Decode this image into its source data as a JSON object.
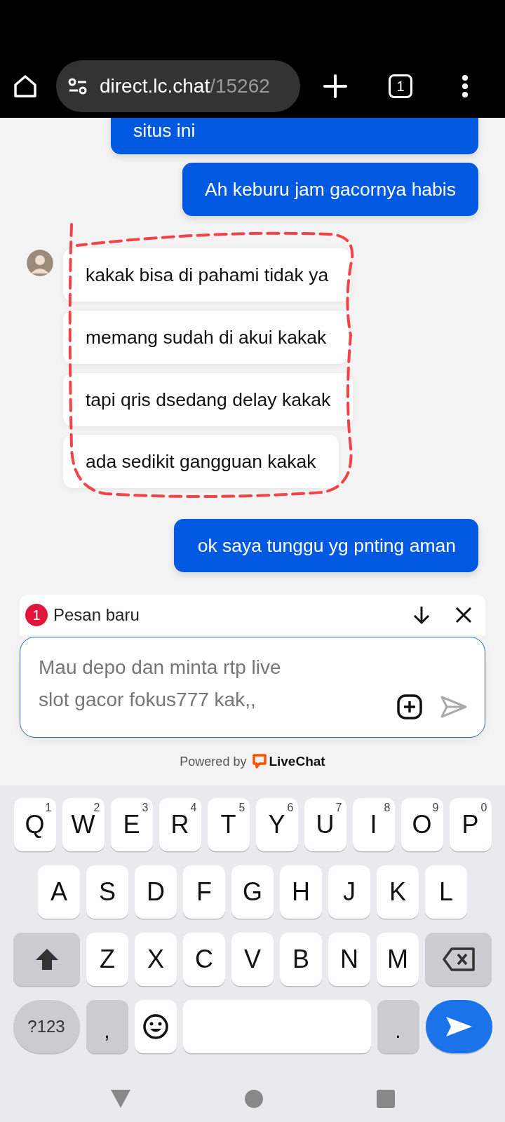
{
  "browser": {
    "url_host": "direct.lc.chat",
    "url_path": "/15262",
    "tab_count": "1"
  },
  "messages": [
    {
      "kind": "customer",
      "text": "situs ini"
    },
    {
      "kind": "customer",
      "text": "Ah keburu jam gacornya habis"
    },
    {
      "kind": "agent",
      "text": "kakak bisa di pahami tidak ya"
    },
    {
      "kind": "agent",
      "text": "memang sudah di akui kakak"
    },
    {
      "kind": "agent",
      "text": "tapi qris dsedang delay kakak"
    },
    {
      "kind": "agent",
      "text": "ada sedikit gangguan kakak"
    },
    {
      "kind": "customer",
      "text": "ok saya tunggu yg pnting aman"
    }
  ],
  "new_message_bar": {
    "count": "1",
    "label": "Pesan baru"
  },
  "composer": {
    "placeholder": "Mau depo dan minta rtp live slot gacor fokus777 kak,,"
  },
  "powered_by": {
    "prefix": "Powered by",
    "brand": "LiveChat"
  },
  "keyboard": {
    "rows": [
      {
        "keys": [
          {
            "kind": "letter",
            "label": "Q",
            "hint": "1"
          },
          {
            "kind": "letter",
            "label": "W",
            "hint": "2"
          },
          {
            "kind": "letter",
            "label": "E",
            "hint": "3"
          },
          {
            "kind": "letter",
            "label": "R",
            "hint": "4"
          },
          {
            "kind": "letter",
            "label": "T",
            "hint": "5"
          },
          {
            "kind": "letter",
            "label": "Y",
            "hint": "6"
          },
          {
            "kind": "letter",
            "label": "U",
            "hint": "7"
          },
          {
            "kind": "letter",
            "label": "I",
            "hint": "8"
          },
          {
            "kind": "letter",
            "label": "O",
            "hint": "9"
          },
          {
            "kind": "letter",
            "label": "P",
            "hint": "0"
          }
        ]
      },
      {
        "keys": [
          {
            "kind": "letter",
            "label": "A"
          },
          {
            "kind": "letter",
            "label": "S"
          },
          {
            "kind": "letter",
            "label": "D"
          },
          {
            "kind": "letter",
            "label": "F"
          },
          {
            "kind": "letter",
            "label": "G"
          },
          {
            "kind": "letter",
            "label": "H"
          },
          {
            "kind": "letter",
            "label": "J"
          },
          {
            "kind": "letter",
            "label": "K"
          },
          {
            "kind": "letter",
            "label": "L"
          }
        ]
      },
      {
        "keys": [
          {
            "kind": "shift"
          },
          {
            "kind": "letter",
            "label": "Z"
          },
          {
            "kind": "letter",
            "label": "X"
          },
          {
            "kind": "letter",
            "label": "C"
          },
          {
            "kind": "letter",
            "label": "V"
          },
          {
            "kind": "letter",
            "label": "B"
          },
          {
            "kind": "letter",
            "label": "N"
          },
          {
            "kind": "letter",
            "label": "M"
          },
          {
            "kind": "backspace"
          }
        ]
      },
      {
        "keys": [
          {
            "kind": "symbols",
            "label": "?123"
          },
          {
            "kind": "punct",
            "label": ","
          },
          {
            "kind": "emoji"
          },
          {
            "kind": "space"
          },
          {
            "kind": "punct",
            "label": "."
          },
          {
            "kind": "enter"
          }
        ]
      }
    ]
  }
}
